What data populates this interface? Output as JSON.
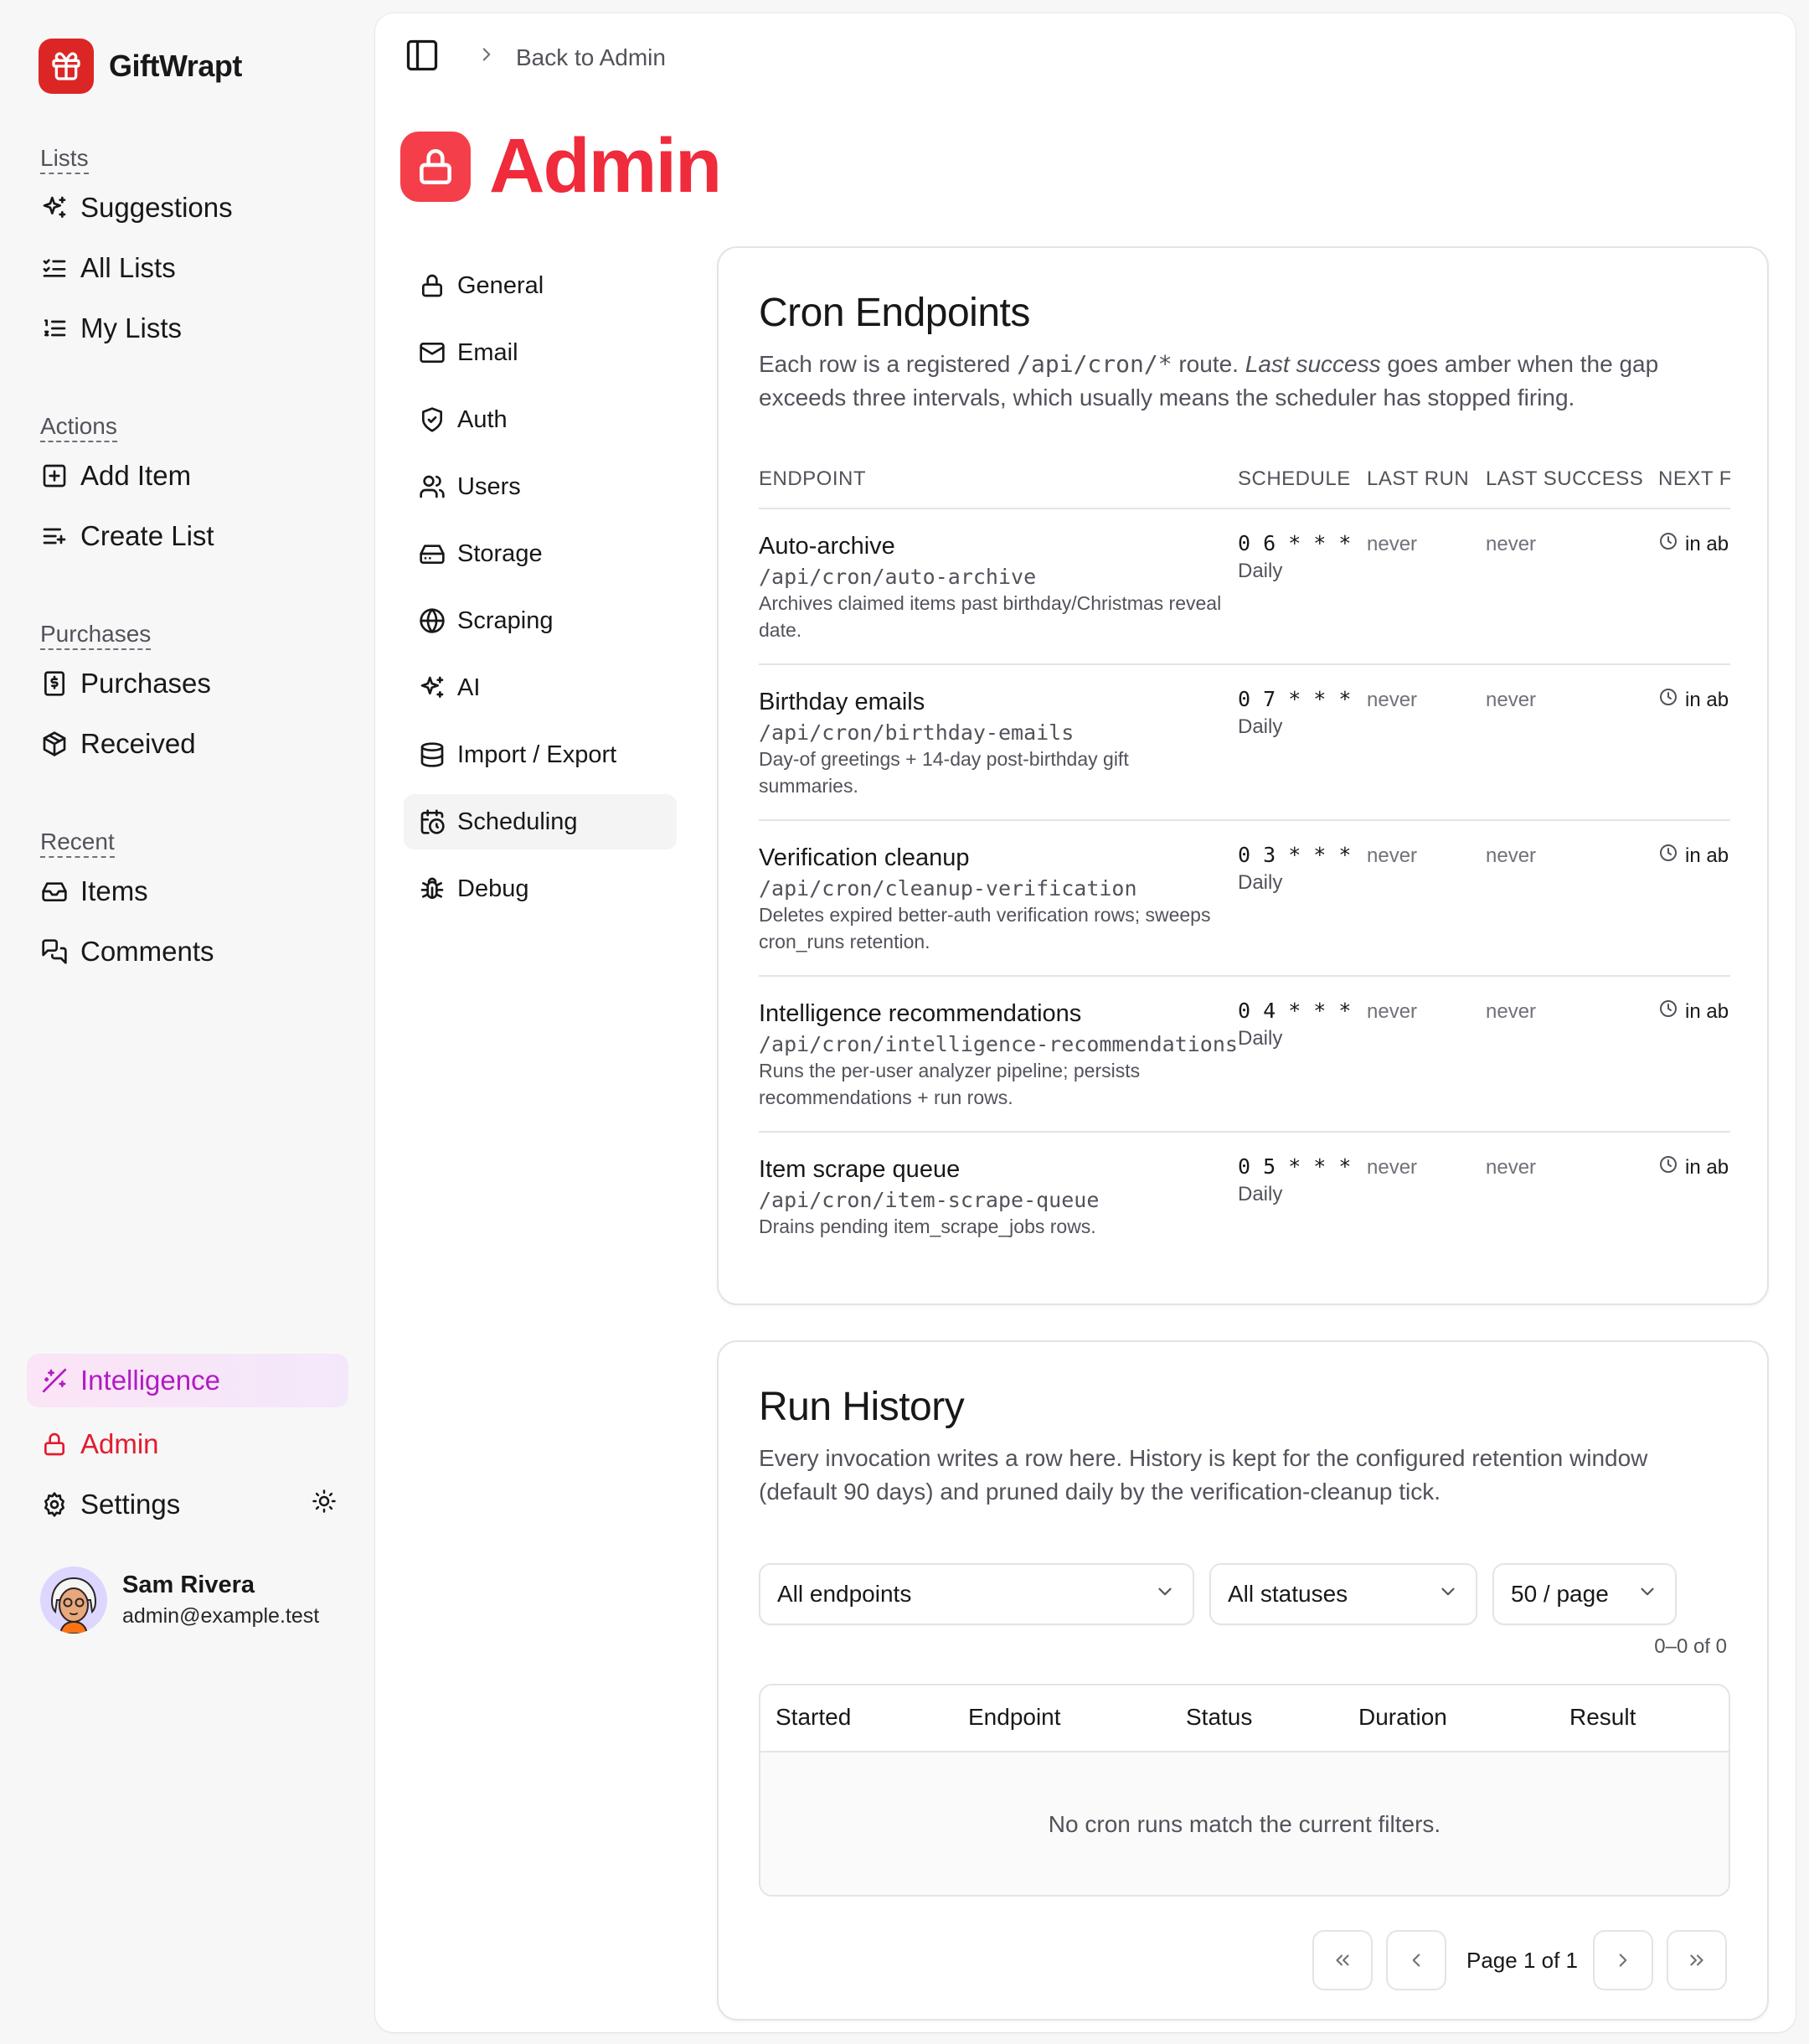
{
  "app": {
    "name": "GiftWrapt"
  },
  "sidebar": {
    "groups": [
      {
        "label": "Lists",
        "items": [
          {
            "label": "Suggestions",
            "icon": "sparkles-icon"
          },
          {
            "label": "All Lists",
            "icon": "list-checks-icon"
          },
          {
            "label": "My Lists",
            "icon": "list-ordered-icon"
          }
        ]
      },
      {
        "label": "Actions",
        "items": [
          {
            "label": "Add Item",
            "icon": "square-plus-icon"
          },
          {
            "label": "Create List",
            "icon": "list-plus-icon"
          }
        ]
      },
      {
        "label": "Purchases",
        "items": [
          {
            "label": "Purchases",
            "icon": "receipt-icon"
          },
          {
            "label": "Received",
            "icon": "package-open-icon"
          }
        ]
      },
      {
        "label": "Recent",
        "items": [
          {
            "label": "Items",
            "icon": "inbox-icon"
          },
          {
            "label": "Comments",
            "icon": "messages-icon"
          }
        ]
      }
    ],
    "bottom": [
      {
        "label": "Intelligence",
        "icon": "wand-sparkles-icon"
      },
      {
        "label": "Admin",
        "icon": "lock-icon"
      },
      {
        "label": "Settings",
        "icon": "gear-icon"
      }
    ],
    "user": {
      "name": "Sam Rivera",
      "email": "admin@example.test"
    }
  },
  "header": {
    "breadcrumb": "Back to Admin"
  },
  "page": {
    "title": "Admin"
  },
  "admin_nav": [
    {
      "label": "General",
      "icon": "lock-icon"
    },
    {
      "label": "Email",
      "icon": "mail-icon"
    },
    {
      "label": "Auth",
      "icon": "shield-check-icon"
    },
    {
      "label": "Users",
      "icon": "users-icon"
    },
    {
      "label": "Storage",
      "icon": "hard-drive-icon"
    },
    {
      "label": "Scraping",
      "icon": "globe-icon"
    },
    {
      "label": "AI",
      "icon": "sparkles-icon"
    },
    {
      "label": "Import / Export",
      "icon": "database-icon"
    },
    {
      "label": "Scheduling",
      "icon": "calendar-clock-icon",
      "active": true
    },
    {
      "label": "Debug",
      "icon": "bug-icon"
    }
  ],
  "cron": {
    "title": "Cron Endpoints",
    "desc_prefix": "Each row is a registered",
    "desc_path": "/api/cron/*",
    "desc_mid": "route.",
    "desc_em": "Last success",
    "desc_suffix": "goes amber when the gap exceeds three intervals, which usually means the scheduler has stopped firing.",
    "columns": {
      "endpoint": "ENDPOINT",
      "schedule": "SCHEDULE",
      "last_run": "LAST RUN",
      "last_success": "LAST SUCCESS",
      "next": "NEXT F"
    },
    "rows": [
      {
        "name": "Auto-archive",
        "path": "/api/cron/auto-archive",
        "desc": "Archives claimed items past birthday/Christmas reveal date.",
        "schedule": "0 6 * * *",
        "freq": "Daily",
        "last_run": "never",
        "last_success": "never",
        "next": "in ab"
      },
      {
        "name": "Birthday emails",
        "path": "/api/cron/birthday-emails",
        "desc": "Day-of greetings + 14-day post-birthday gift summaries.",
        "schedule": "0 7 * * *",
        "freq": "Daily",
        "last_run": "never",
        "last_success": "never",
        "next": "in ab"
      },
      {
        "name": "Verification cleanup",
        "path": "/api/cron/cleanup-verification",
        "desc": "Deletes expired better-auth verification rows; sweeps cron_runs retention.",
        "schedule": "0 3 * * *",
        "freq": "Daily",
        "last_run": "never",
        "last_success": "never",
        "next": "in ab"
      },
      {
        "name": "Intelligence recommendations",
        "path": "/api/cron/intelligence-recommendations",
        "desc": "Runs the per-user analyzer pipeline; persists recommendations + run rows.",
        "schedule": "0 4 * * *",
        "freq": "Daily",
        "last_run": "never",
        "last_success": "never",
        "next": "in ab"
      },
      {
        "name": "Item scrape queue",
        "path": "/api/cron/item-scrape-queue",
        "desc": "Drains pending item_scrape_jobs rows.",
        "schedule": "0 5 * * *",
        "freq": "Daily",
        "last_run": "never",
        "last_success": "never",
        "next": "in ab"
      }
    ]
  },
  "history": {
    "title": "Run History",
    "desc": "Every invocation writes a row here. History is kept for the configured retention window (default 90 days) and pruned daily by the verification-cleanup tick.",
    "filters": {
      "endpoint": "All endpoints",
      "status": "All statuses",
      "page_size": "50 / page"
    },
    "count": "0–0 of 0",
    "columns": {
      "started": "Started",
      "endpoint": "Endpoint",
      "status": "Status",
      "duration": "Duration",
      "result": "Result"
    },
    "empty": "No cron runs match the current filters.",
    "page_info": "Page 1 of 1"
  },
  "colors": {
    "brand": "#dc2626",
    "admin_red": "#ef2b3c",
    "intelligence": "#b21bc5"
  }
}
